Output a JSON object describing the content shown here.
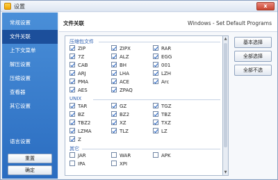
{
  "window": {
    "title": "设置",
    "close_label": "x"
  },
  "sidebar": {
    "items": [
      {
        "label": "常规设置",
        "active": false
      },
      {
        "label": "文件关联",
        "active": true
      },
      {
        "label": "上下文菜单",
        "active": false
      },
      {
        "label": "解压设置",
        "active": false
      },
      {
        "label": "压缩设置",
        "active": false
      },
      {
        "label": "查看器",
        "active": false
      },
      {
        "label": "其它设置",
        "active": false
      },
      {
        "label": "语言设置",
        "active": false
      }
    ],
    "reset_label": "重置",
    "ok_label": "确定"
  },
  "main": {
    "section_title": "文件关联",
    "header_right": "Windows - Set Default Programs",
    "groups": [
      {
        "label": "压缩包文件",
        "items": [
          [
            "ZIP",
            true
          ],
          [
            "ZIPX",
            true
          ],
          [
            "RAR",
            true
          ],
          [
            "7Z",
            true
          ],
          [
            "ALZ",
            true
          ],
          [
            "EGG",
            true
          ],
          [
            "CAB",
            true
          ],
          [
            "BH",
            true
          ],
          [
            "001",
            true
          ],
          [
            "ARJ",
            true
          ],
          [
            "LHA",
            true
          ],
          [
            "LZH",
            true
          ],
          [
            "PMA",
            true
          ],
          [
            "ACE",
            true
          ],
          [
            "Arc",
            true
          ],
          [
            "AES",
            true
          ],
          [
            "ZPAQ",
            true
          ]
        ]
      },
      {
        "label": "UNIX",
        "items": [
          [
            "TAR",
            true
          ],
          [
            "GZ",
            true
          ],
          [
            "TGZ",
            true
          ],
          [
            "BZ",
            true
          ],
          [
            "BZ2",
            true
          ],
          [
            "TBZ",
            true
          ],
          [
            "TBZ2",
            true
          ],
          [
            "XZ",
            true
          ],
          [
            "TXZ",
            true
          ],
          [
            "LZMA",
            true
          ],
          [
            "TLZ",
            true
          ],
          [
            "LZ",
            true
          ],
          [
            "Z",
            true
          ]
        ]
      },
      {
        "label": "其它",
        "items": [
          [
            "JAR",
            false
          ],
          [
            "WAR",
            false
          ],
          [
            "APK",
            false
          ],
          [
            "IPA",
            false
          ],
          [
            "XPI",
            false
          ]
        ]
      }
    ],
    "buttons": {
      "basic": "基本选择",
      "all": "全部选择",
      "none": "全部不选"
    }
  }
}
